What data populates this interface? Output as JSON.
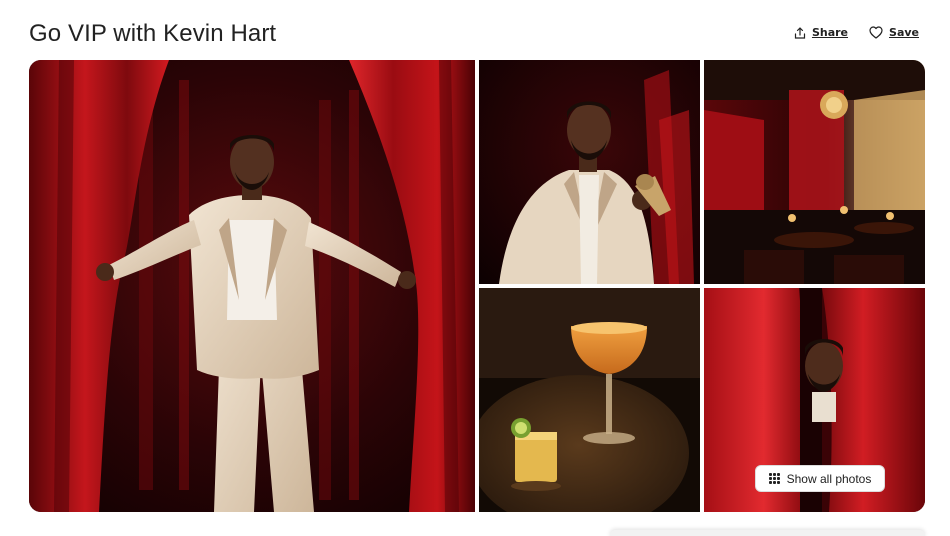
{
  "page": {
    "title": "Go VIP with Kevin Hart"
  },
  "actions": {
    "share_label": "Share",
    "save_label": "Save",
    "share_icon": "share-icon",
    "save_icon": "heart-icon"
  },
  "gallery": {
    "photos": [
      {
        "name": "main-photo",
        "alt": "Kevin Hart between red curtains"
      },
      {
        "name": "photo-microphone",
        "alt": "Kevin Hart with microphone"
      },
      {
        "name": "photo-lounge",
        "alt": "Red velvet lounge interior"
      },
      {
        "name": "photo-cocktail",
        "alt": "Cocktail glasses on table"
      },
      {
        "name": "photo-curtain-peek",
        "alt": "Kevin Hart peeking from curtain"
      }
    ],
    "show_all_label": "Show all photos",
    "show_all_icon": "grid-icon"
  },
  "colors": {
    "curtain_red": "#b0141a",
    "dark_red": "#3a0608",
    "gold": "#d89a3a",
    "text": "#222222"
  }
}
